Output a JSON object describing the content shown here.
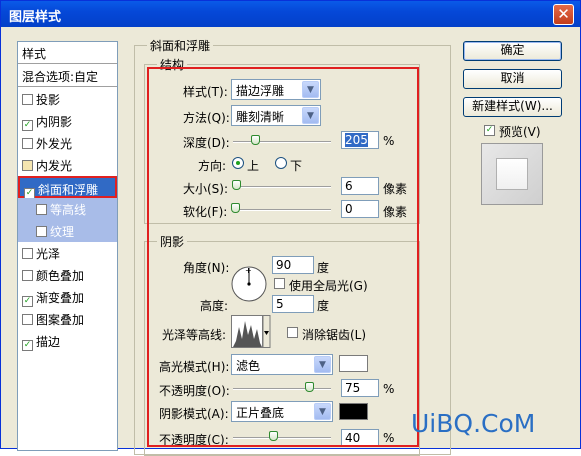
{
  "window": {
    "title": "图层样式"
  },
  "sidebar": {
    "header": "样式",
    "blend_options": "混合选项:自定",
    "items": [
      {
        "label": "投影",
        "checked": false
      },
      {
        "label": "内阴影",
        "checked": true
      },
      {
        "label": "外发光",
        "checked": false
      },
      {
        "label": "内发光",
        "checked": false
      },
      {
        "label": "斜面和浮雕",
        "checked": true,
        "selected": true
      },
      {
        "label": "等高线",
        "checked": false,
        "sub": true
      },
      {
        "label": "纹理",
        "checked": false,
        "sub": true
      },
      {
        "label": "光泽",
        "checked": false
      },
      {
        "label": "颜色叠加",
        "checked": false
      },
      {
        "label": "渐变叠加",
        "checked": true
      },
      {
        "label": "图案叠加",
        "checked": false
      },
      {
        "label": "描边",
        "checked": true
      }
    ]
  },
  "bevel": {
    "section_title": "斜面和浮雕",
    "structure_title": "结构",
    "style_label": "样式(T):",
    "style_value": "描边浮雕",
    "technique_label": "方法(Q):",
    "technique_value": "雕刻清晰",
    "depth_label": "深度(D):",
    "depth_value": "205",
    "depth_unit": "%",
    "direction_label": "方向:",
    "direction_up": "上",
    "direction_down": "下",
    "size_label": "大小(S):",
    "size_value": "6",
    "size_unit": "像素",
    "soften_label": "软化(F):",
    "soften_value": "0",
    "soften_unit": "像素"
  },
  "shading": {
    "title": "阴影",
    "angle_label": "角度(N):",
    "angle_value": "90",
    "angle_unit": "度",
    "global_light_label": "使用全局光(G)",
    "altitude_label": "高度:",
    "altitude_value": "5",
    "altitude_unit": "度",
    "gloss_label": "光泽等高线:",
    "anti_alias_label": "消除锯齿(L)",
    "highlight_mode_label": "高光模式(H):",
    "highlight_mode_value": "滤色",
    "highlight_color": "#ffffff",
    "highlight_opacity_label": "不透明度(O):",
    "highlight_opacity_value": "75",
    "highlight_opacity_unit": "%",
    "shadow_mode_label": "阴影模式(A):",
    "shadow_mode_value": "正片叠底",
    "shadow_color": "#000000",
    "shadow_opacity_label": "不透明度(C):",
    "shadow_opacity_value": "40",
    "shadow_opacity_unit": "%"
  },
  "buttons": {
    "ok": "确定",
    "cancel": "取消",
    "new_style": "新建样式(W)...",
    "preview": "预览(V)"
  },
  "watermark": "UiBQ.CoM"
}
